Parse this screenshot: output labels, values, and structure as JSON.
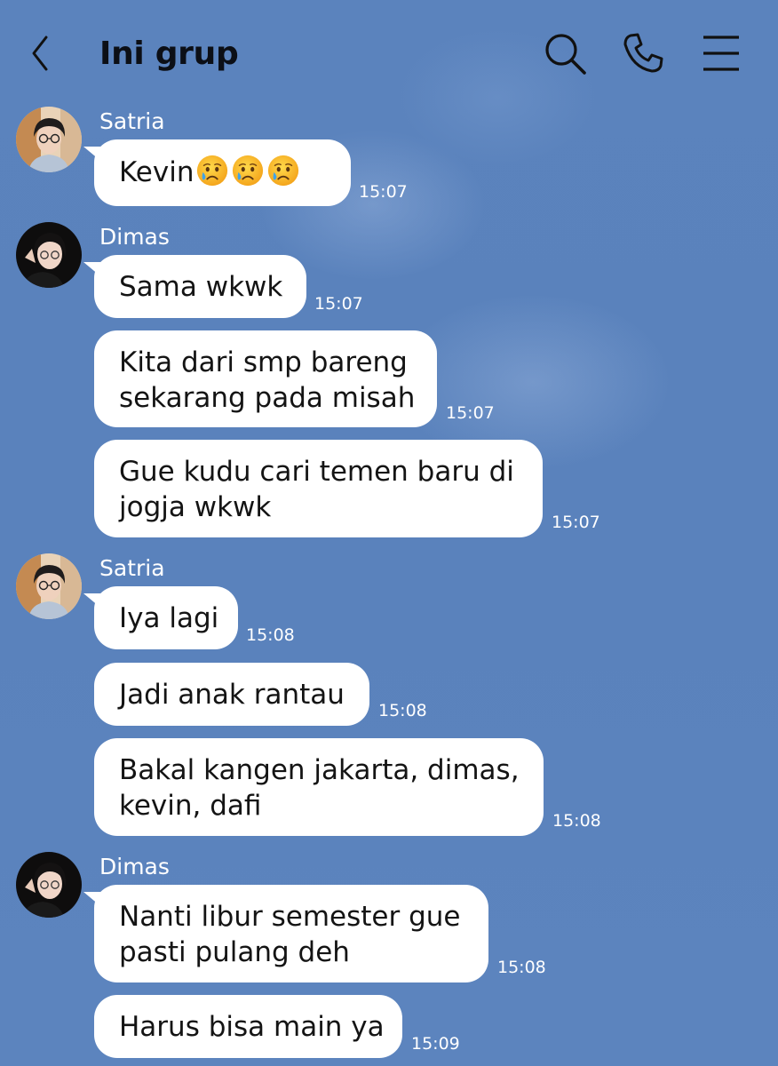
{
  "header": {
    "title": "Ini grup",
    "icons": [
      "back-icon",
      "search-icon",
      "phone-icon",
      "menu-icon"
    ]
  },
  "participants": {
    "satria": "Satria",
    "dimas": "Dimas"
  },
  "messages": [
    {
      "sender": "Satria",
      "lines": [
        "Kevin"
      ],
      "emoji": [
        "crying-face",
        "crying-face",
        "crying-face"
      ],
      "time": "15:07"
    },
    {
      "sender": "Dimas",
      "lines": [
        "Sama wkwk"
      ],
      "time": "15:07"
    },
    {
      "sender": "Dimas",
      "lines": [
        "Kita dari smp bareng",
        "sekarang pada misah"
      ],
      "time": "15:07"
    },
    {
      "sender": "Dimas",
      "lines": [
        "Gue kudu cari temen baru di",
        "jogja wkwk"
      ],
      "time": "15:07"
    },
    {
      "sender": "Satria",
      "lines": [
        "Iya lagi"
      ],
      "time": "15:08"
    },
    {
      "sender": "Satria",
      "lines": [
        "Jadi anak rantau"
      ],
      "time": "15:08"
    },
    {
      "sender": "Satria",
      "lines": [
        "Bakal kangen jakarta, dimas,",
        "kevin, dafi"
      ],
      "time": "15:08"
    },
    {
      "sender": "Dimas",
      "lines": [
        "Nanti libur semester gue",
        "pasti pulang deh"
      ],
      "time": "15:08"
    },
    {
      "sender": "Dimas",
      "lines": [
        "Harus bisa main ya"
      ],
      "time": "15:09"
    }
  ]
}
